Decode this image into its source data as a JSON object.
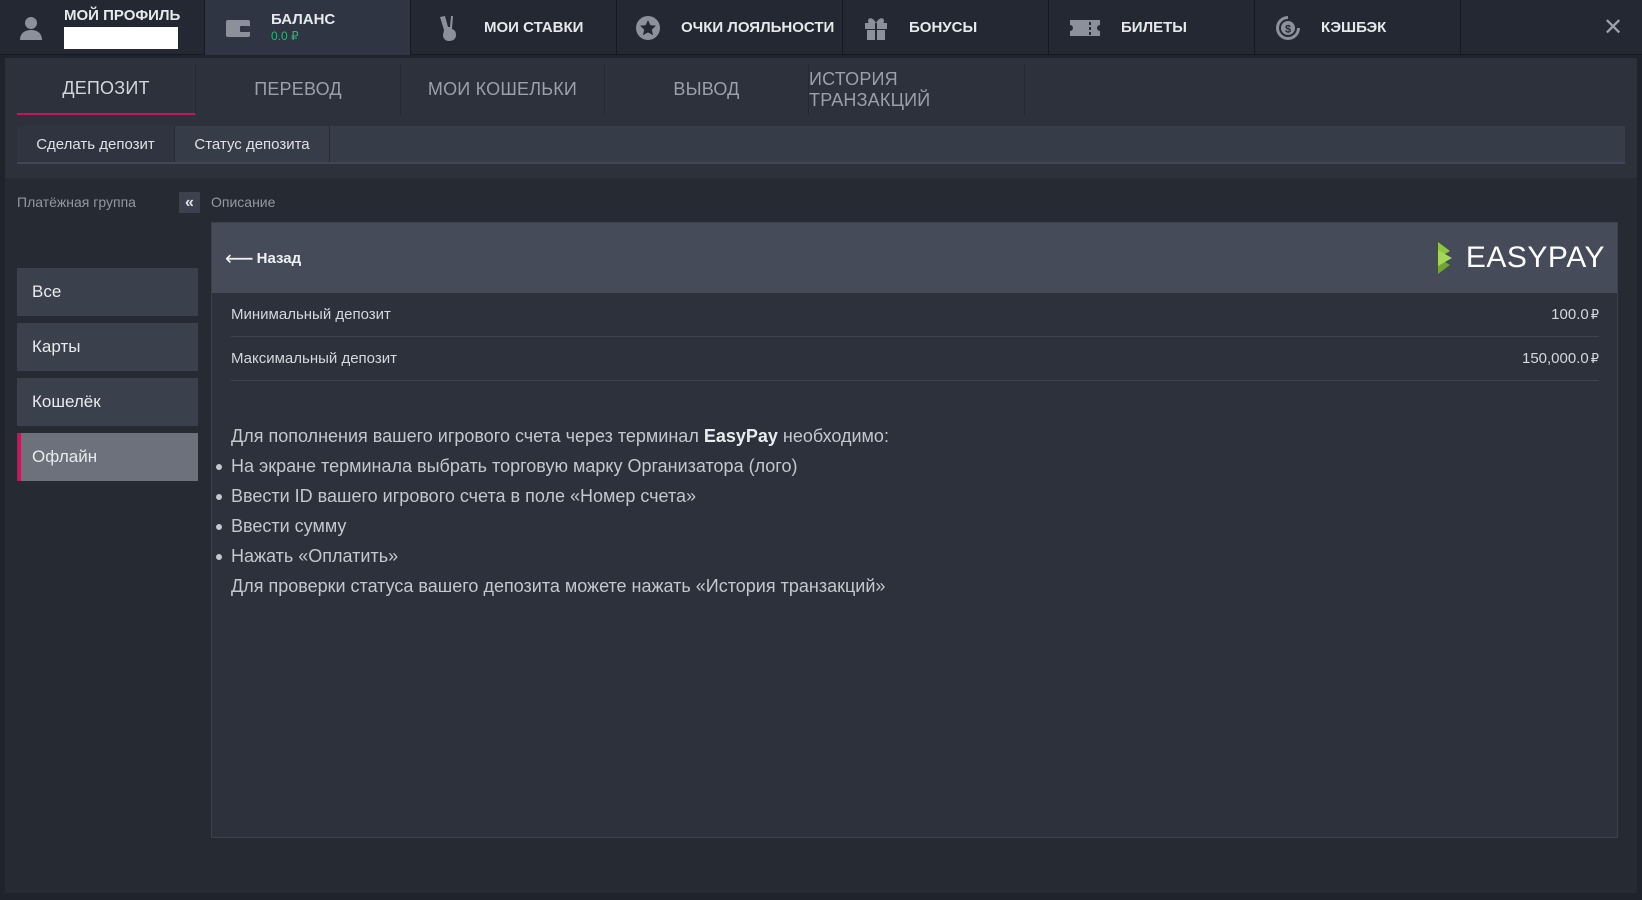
{
  "topnav": {
    "profile": {
      "label": "МОЙ ПРОФИЛЬ"
    },
    "balance": {
      "label": "БАЛАНС",
      "amount": "0.0",
      "currency_symbol": "₽"
    },
    "bets": {
      "label": "МОИ СТАВКИ"
    },
    "loyalty": {
      "label": "ОЧКИ ЛОЯЛЬНОСТИ"
    },
    "bonuses": {
      "label": "БОНУСЫ"
    },
    "tickets": {
      "label": "БИЛЕТЫ"
    },
    "cashback": {
      "label": "КЭШБЭК"
    },
    "close": "✕"
  },
  "tabs": [
    "ДЕПОЗИТ",
    "ПЕРЕВОД",
    "МОИ КОШЕЛЬКИ",
    "ВЫВОД",
    "ИСТОРИЯ ТРАНЗАКЦИЙ"
  ],
  "subtabs": [
    "Сделать депозит",
    "Статус депозита"
  ],
  "sidebar": {
    "title": "Платёжная группа",
    "collapse": "«",
    "items": [
      "Все",
      "Карты",
      "Кошелёк",
      "Офлайн"
    ],
    "active_index": 3
  },
  "description": {
    "title": "Описание",
    "back_arrow": "⟵",
    "back_label": "Назад",
    "logo": {
      "part1": "EASY",
      "part2": "PAY"
    },
    "min_label": "Минимальный депозит",
    "min_value": "100.0",
    "max_label": "Максимальный депозит",
    "max_value": "150,000.0",
    "currency_symbol": "₽",
    "intro_prefix": "Для пополнения вашего игрового счета через терминал ",
    "intro_brand": "EasyPay",
    "intro_suffix": " необходимо:",
    "steps": [
      "На экране терминала выбрать торговую марку Организатора (лого)",
      "Ввести ID вашего игрового счета в поле «Номер счета»",
      "Ввести сумму",
      "Нажать «Оплатить»"
    ],
    "footer": "Для проверки статуса вашего депозита можете нажать «История транзакций»"
  },
  "colors": {
    "accent": "#c2185b",
    "balance_green": "#2bb673",
    "logo_green": "#8dc63f"
  }
}
